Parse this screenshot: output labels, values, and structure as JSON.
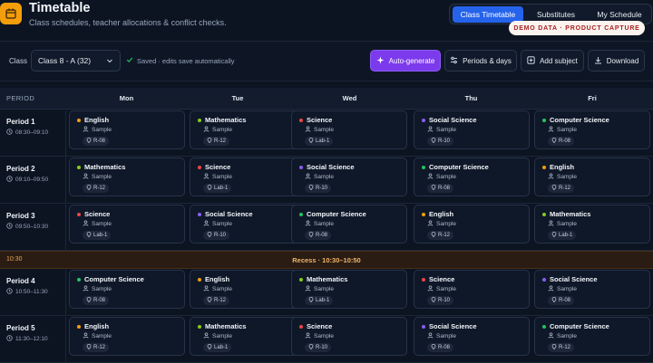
{
  "header": {
    "title": "Timetable",
    "subtitle": "Class schedules, teacher allocations & conflict checks.",
    "icon": "calendar-icon",
    "tabs": [
      {
        "label": "Class Timetable",
        "active": true
      },
      {
        "label": "Substitutes",
        "active": false
      },
      {
        "label": "My Schedule",
        "active": false
      }
    ],
    "demo_badge": "DEMO DATA · PRODUCT CAPTURE"
  },
  "controls": {
    "class_label": "Class",
    "class_value": "Class 8 - A (32)",
    "saved_text": "Saved · edits save automatically",
    "buttons": {
      "autogen": "Auto-generate",
      "periods": "Periods & days",
      "add_subject": "Add subject",
      "download": "Download"
    },
    "accent_color": "#7c3aed"
  },
  "grid": {
    "period_header": "PERIOD",
    "days": [
      "Mon",
      "Tue",
      "Wed",
      "Thu",
      "Fri"
    ],
    "periods": [
      {
        "name": "Period 1",
        "time": "08:30–09:10"
      },
      {
        "name": "Period 2",
        "time": "09:10–09:50"
      },
      {
        "name": "Period 3",
        "time": "09:50–10:30"
      },
      {
        "name": "Period 4",
        "time": "10:50–11:30"
      },
      {
        "name": "Period 5",
        "time": "11:30–12:10"
      }
    ],
    "recess": {
      "time": "10:30",
      "label": "Recess · 10:30–10:50"
    },
    "subject_colors": {
      "English": "#f59e0b",
      "Mathematics": "#84cc16",
      "Science": "#ef4444",
      "Social Science": "#8b5cf6",
      "Computer Science": "#22c55e"
    },
    "rows": [
      [
        {
          "subject": "English",
          "teacher": "Sample",
          "room": "R-08"
        },
        {
          "subject": "Mathematics",
          "teacher": "Sample",
          "room": "R-12"
        },
        {
          "subject": "Science",
          "teacher": "Sample",
          "room": "Lab-1"
        },
        {
          "subject": "Social Science",
          "teacher": "Sample",
          "room": "R-10"
        },
        {
          "subject": "Computer Science",
          "teacher": "Sample",
          "room": "R-08"
        }
      ],
      [
        {
          "subject": "Mathematics",
          "teacher": "Sample",
          "room": "R-12"
        },
        {
          "subject": "Science",
          "teacher": "Sample",
          "room": "Lab-1"
        },
        {
          "subject": "Social Science",
          "teacher": "Sample",
          "room": "R-10"
        },
        {
          "subject": "Computer Science",
          "teacher": "Sample",
          "room": "R-08"
        },
        {
          "subject": "English",
          "teacher": "Sample",
          "room": "R-12"
        }
      ],
      [
        {
          "subject": "Science",
          "teacher": "Sample",
          "room": "Lab-1"
        },
        {
          "subject": "Social Science",
          "teacher": "Sample",
          "room": "R-10"
        },
        {
          "subject": "Computer Science",
          "teacher": "Sample",
          "room": "R-08"
        },
        {
          "subject": "English",
          "teacher": "Sample",
          "room": "R-12"
        },
        {
          "subject": "Mathematics",
          "teacher": "Sample",
          "room": "Lab-1"
        }
      ],
      [
        {
          "subject": "Computer Science",
          "teacher": "Sample",
          "room": "R-08"
        },
        {
          "subject": "English",
          "teacher": "Sample",
          "room": "R-12"
        },
        {
          "subject": "Mathematics",
          "teacher": "Sample",
          "room": "Lab-1"
        },
        {
          "subject": "Science",
          "teacher": "Sample",
          "room": "R-10"
        },
        {
          "subject": "Social Science",
          "teacher": "Sample",
          "room": "R-08"
        }
      ],
      [
        {
          "subject": "English",
          "teacher": "Sample",
          "room": "R-12"
        },
        {
          "subject": "Mathematics",
          "teacher": "Sample",
          "room": "Lab-1"
        },
        {
          "subject": "Science",
          "teacher": "Sample",
          "room": "R-10"
        },
        {
          "subject": "Social Science",
          "teacher": "Sample",
          "room": "R-08"
        },
        {
          "subject": "Computer Science",
          "teacher": "Sample",
          "room": "R-12"
        }
      ]
    ]
  }
}
